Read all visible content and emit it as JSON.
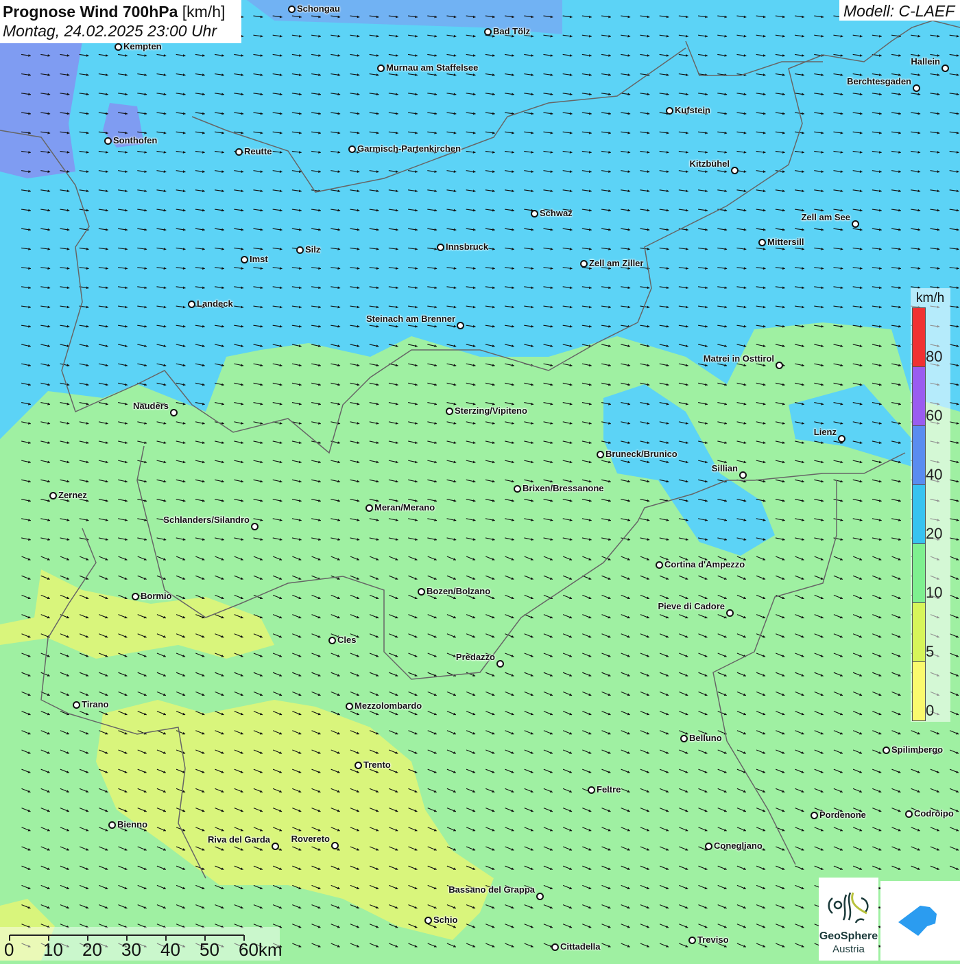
{
  "header": {
    "title_bold": "Prognose Wind 700hPa",
    "title_unit": "[km/h]",
    "datetime": "Montag, 24.02.2025 23:00 Uhr",
    "model": "Modell: C-LAEF"
  },
  "legend": {
    "unit": "km/h",
    "labels": [
      "80",
      "60",
      "40",
      "20",
      "10",
      "5",
      "0"
    ],
    "colors": [
      "#f03232",
      "#9a5cf0",
      "#5a8cf0",
      "#37c3f0",
      "#7ff090",
      "#d7f55a",
      "#fafa6e"
    ]
  },
  "scale": {
    "labels": [
      "0",
      "10",
      "20",
      "30",
      "40",
      "50",
      "60km"
    ]
  },
  "logos": {
    "geosphere": "GeoSphere",
    "austria": "Austria"
  },
  "cities": [
    "Schongau",
    "Bad Tölz",
    "Kempten",
    "Murnau am Staffelsee",
    "Hallein",
    "Berchtesgaden",
    "Kufstein",
    "Sonthofen",
    "Reutte",
    "Garmisch-Partenkirchen",
    "Kitzbühel",
    "Schwaz",
    "Zell am See",
    "Innsbruck",
    "Mittersill",
    "Silz",
    "Imst",
    "Zell am Ziller",
    "Landeck",
    "Steinach am Brenner",
    "Matrei in Osttirol",
    "Nauders",
    "Sterzing/Vipiteno",
    "Lienz",
    "Bruneck/Brunico",
    "Sillian",
    "Zernez",
    "Brixen/Bressanone",
    "Meran/Merano",
    "Schlanders/Silandro",
    "Cortina d'Ampezzo",
    "Bozen/Bolzano",
    "Bormio",
    "Pieve di Cadore",
    "Cles",
    "Predazzo",
    "Tirano",
    "Mezzolombardo",
    "Belluno",
    "Spilimbergo",
    "Trento",
    "Feltre",
    "Bienno",
    "Pordenone",
    "Codroipo",
    "Riva del Garda",
    "Rovereto",
    "Conegliano",
    "Bassano del Grappa",
    "Schio",
    "Treviso",
    "Cittadella"
  ],
  "colors": {
    "cyan": "#5cd3f6",
    "green": "#9ff0a2",
    "yellow": "#d9f57c",
    "blue": "#7f9cf2"
  }
}
